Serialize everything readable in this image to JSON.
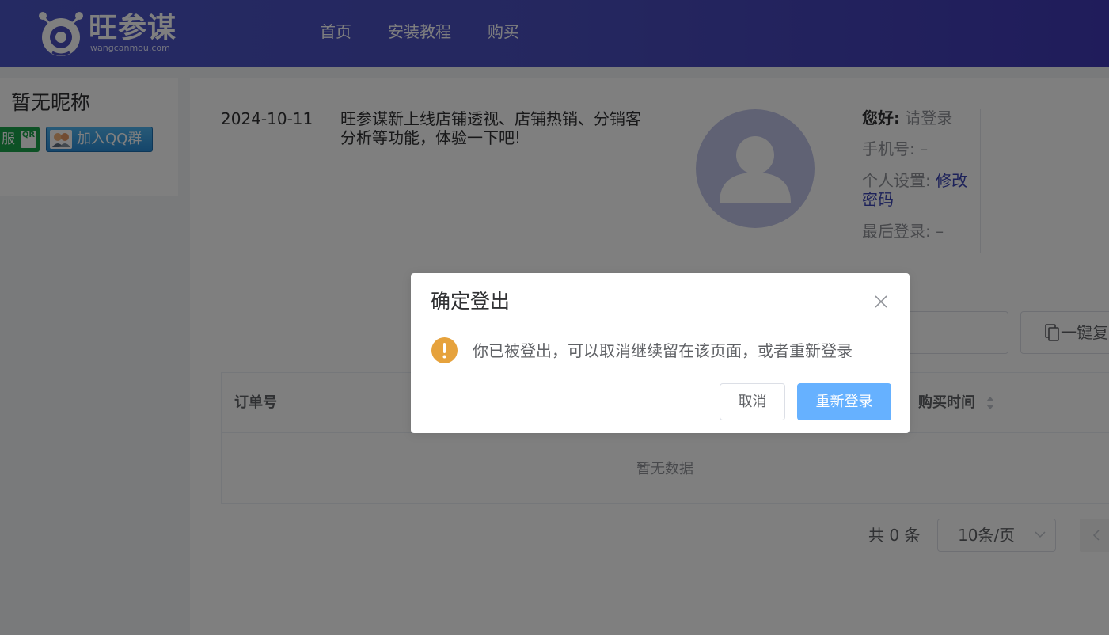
{
  "header": {
    "logo_text": "旺参谋",
    "logo_sub": "wangcanmou.com",
    "nav": [
      "首页",
      "安装教程",
      "购买"
    ]
  },
  "profile": {
    "nickname": "暂无昵称",
    "service_label": "服",
    "qr_label": "QR",
    "qq_label": "加入QQ群"
  },
  "notice": {
    "date": "2024-10-11",
    "text": "旺参谋新上线店铺透视、店铺热销、分销客分析等功能，体验一下吧!"
  },
  "user": {
    "greet_label": "您好:",
    "greet_value": "请登录",
    "phone_label": "手机号:",
    "phone_value": "–",
    "settings_label": "个人设置:",
    "settings_link": "修改密码",
    "last_login_label": "最后登录:",
    "last_login_value": "–"
  },
  "toolbar": {
    "copy_label": "一键复"
  },
  "table": {
    "col_order": "订单号",
    "col_time": "购买时间",
    "empty": "暂无数据"
  },
  "pager": {
    "total": "共 0 条",
    "size": "10条/页"
  },
  "dialog": {
    "title": "确定登出",
    "message": "你已被登出，可以取消继续留在该页面，或者重新登录",
    "cancel": "取消",
    "confirm": "重新登录"
  },
  "colors": {
    "header": "#4a4fbf",
    "primary_light": "#66b1ff",
    "warning": "#e6a23c",
    "link": "#3a44b5"
  }
}
